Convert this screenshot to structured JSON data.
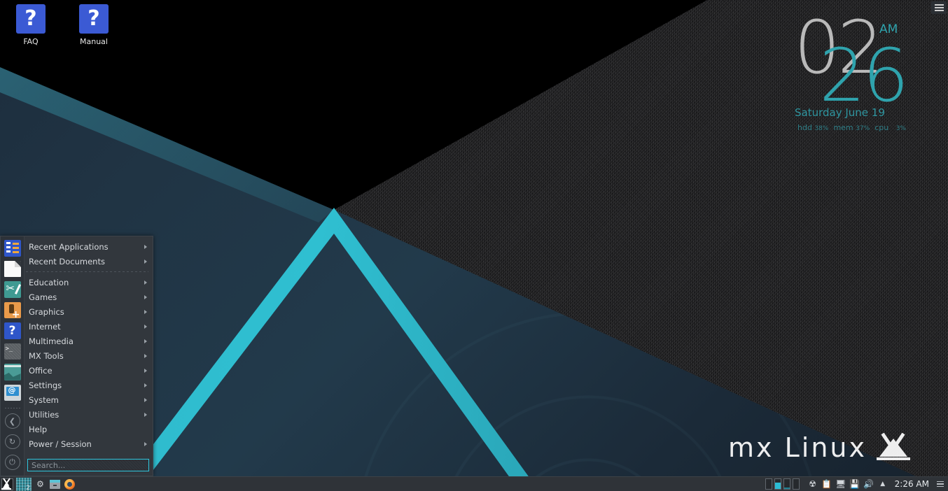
{
  "desktop": {
    "icons": [
      {
        "label": "FAQ",
        "glyph": "?",
        "icon_name": "faq-help-icon"
      },
      {
        "label": "Manual",
        "glyph": "?",
        "icon_name": "manual-help-icon"
      }
    ],
    "watermark": {
      "text": "mx Linux"
    }
  },
  "conky": {
    "hours": "02",
    "minutes": "26",
    "ampm": "AM",
    "date": "Saturday   June 19",
    "stats": {
      "hdd_label": "hdd",
      "hdd_value": "38%",
      "mem_label": "mem",
      "mem_value": "37%",
      "cpu_label": "cpu",
      "cpu_value": "3%"
    },
    "colors": {
      "hours": "#b9b9b9",
      "minutes": "#2fa3ad",
      "accent": "#2f96a0"
    }
  },
  "menu": {
    "sidebar": [
      {
        "name": "recent-applications-icon"
      },
      {
        "name": "documents-icon"
      },
      {
        "name": "mx-tools-icon"
      },
      {
        "name": "package-installer-icon"
      },
      {
        "name": "help-icon"
      },
      {
        "name": "terminal-icon"
      },
      {
        "name": "system-monitor-icon"
      },
      {
        "name": "about-icon"
      },
      {
        "name": "logout-icon"
      },
      {
        "name": "restart-icon"
      },
      {
        "name": "shutdown-icon"
      }
    ],
    "items": [
      {
        "label": "Recent Applications",
        "submenu": true
      },
      {
        "label": "Recent Documents",
        "submenu": true
      },
      {
        "separator": true
      },
      {
        "label": "Education",
        "submenu": true
      },
      {
        "label": "Games",
        "submenu": true
      },
      {
        "label": "Graphics",
        "submenu": true
      },
      {
        "label": "Internet",
        "submenu": true
      },
      {
        "label": "Multimedia",
        "submenu": true
      },
      {
        "label": "MX Tools",
        "submenu": true
      },
      {
        "label": "Office",
        "submenu": true
      },
      {
        "label": "Settings",
        "submenu": true
      },
      {
        "label": "System",
        "submenu": true
      },
      {
        "label": "Utilities",
        "submenu": true
      },
      {
        "label": "Help",
        "submenu": false
      },
      {
        "label": "Power / Session",
        "submenu": true
      }
    ],
    "search": {
      "value": "",
      "placeholder": "Search...",
      "border_color": "#2fc6dd"
    }
  },
  "panel": {
    "launchers": [
      {
        "name": "whisker-menu-button",
        "label": ""
      },
      {
        "name": "show-desktop-button",
        "label": "2"
      },
      {
        "name": "settings-gears-launcher",
        "label": ""
      },
      {
        "name": "package-manager-launcher",
        "label": ""
      },
      {
        "name": "firefox-launcher",
        "label": ""
      }
    ],
    "workspaces": [
      {
        "index": 1,
        "active": false
      },
      {
        "index": 2,
        "active": true
      },
      {
        "index": 3,
        "active": false
      },
      {
        "index": 4,
        "active": false
      }
    ],
    "tray": [
      {
        "name": "package-updater-icon",
        "glyph": "☸"
      },
      {
        "name": "clipboard-manager-icon",
        "glyph": "Ὄb"
      },
      {
        "name": "network-manager-icon",
        "glyph": "὚7"
      },
      {
        "name": "disk-usage-icon",
        "glyph": "Ὓ4"
      },
      {
        "name": "volume-icon",
        "glyph": "🔊"
      },
      {
        "name": "show-hidden-icons-arrow",
        "glyph": "▲"
      }
    ],
    "clock": "2:26 AM"
  }
}
